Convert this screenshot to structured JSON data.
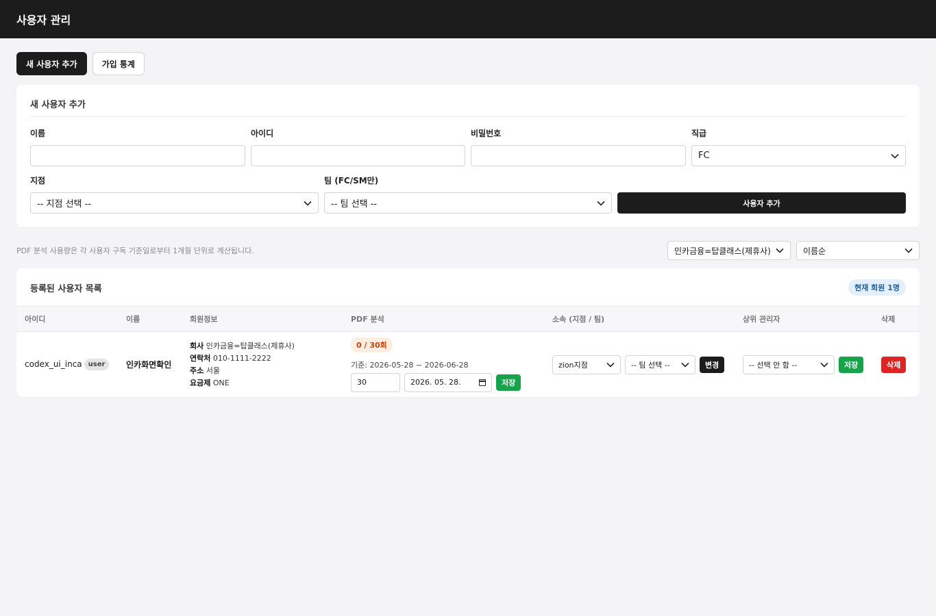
{
  "header": {
    "title": "사용자 관리"
  },
  "tabs": [
    {
      "label": "새 사용자 추가",
      "active": true
    },
    {
      "label": "가입 통계",
      "active": false
    }
  ],
  "form": {
    "title": "새 사용자 추가",
    "name_label": "이름",
    "name_value": "",
    "id_label": "아이디",
    "id_value": "",
    "password_label": "비밀번호",
    "password_value": "",
    "rank_label": "직급",
    "rank_value": "FC",
    "branch_label": "지점",
    "branch_value": "-- 지점 선택 --",
    "team_label": "팀 (FC/SM만)",
    "team_value": "-- 팀 선택 --",
    "submit_label": "사용자 추가"
  },
  "filters": {
    "note": "PDF 분석 사용량은 각 사용자 구독 기준일로부터 1개월 단위로 계산됩니다.",
    "company_value": "인카금융=탑클래스(제휴사)",
    "sort_value": "이름순"
  },
  "list": {
    "title": "등록된 사용자 목록",
    "count_badge": "현재 회원 1명",
    "columns": [
      "아이디",
      "이름",
      "회원정보",
      "PDF 분석",
      "소속 (지점 / 팀)",
      "상위 관리자",
      "삭제"
    ],
    "rows": [
      {
        "user_id": "codex_ui_inca",
        "role": "user",
        "name": "인카화면확인",
        "company_label": "회사",
        "company": "인카금융=탑클래스(제휴사)",
        "phone_label": "연락처",
        "phone": "010-1111-2222",
        "address_label": "주소",
        "address": "서울",
        "plan_label": "요금제",
        "plan": "ONE",
        "usage": "0 / 30회",
        "usage_percent": 0,
        "period": "기준: 2026-05-28 ~ 2026-06-28",
        "limit_value": "30",
        "date_value": "2026. 05. 28.",
        "save_usage_label": "저장",
        "branch_value": "zion지점",
        "team_value": "-- 팀 선택 --",
        "change_label": "변경",
        "manager_value": "-- 선택 안 함 --",
        "save_manager_label": "저장",
        "delete_label": "삭제"
      }
    ]
  },
  "colors": {
    "topbar": "#1c1c1c",
    "accent_dark": "#1c1c1c",
    "save_green": "#16a34a",
    "delete_red": "#dc2626",
    "usage_orange": "#c2410c",
    "count_blue": "#1d5fa0"
  },
  "icons": {
    "select_arrow": "chevron-down-icon",
    "date_picker": "calendar-icon"
  }
}
